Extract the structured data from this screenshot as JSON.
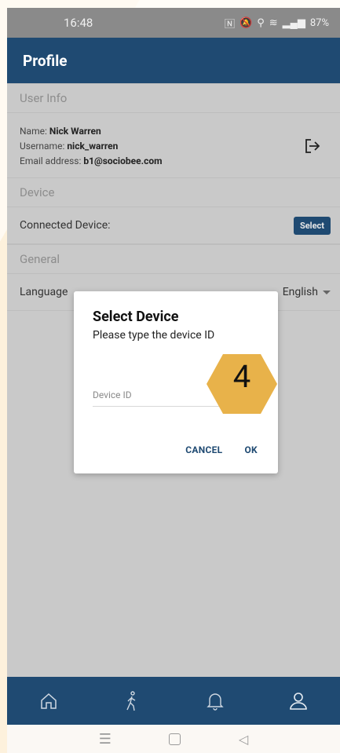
{
  "status_bar": {
    "time": "16:48",
    "speed": "99.0\nKB/S",
    "battery": "87%"
  },
  "app_bar": {
    "title": "Profile"
  },
  "sections": {
    "user_info": "User Info",
    "device": "Device",
    "general": "General"
  },
  "user": {
    "name_label": "Name: ",
    "name": "Nick Warren",
    "username_label": "Username: ",
    "username": "nick_warren",
    "email_label": "Email address: ",
    "email": "b1@sociobee.com"
  },
  "device": {
    "connected_label": "Connected Device:",
    "select_label": "Select"
  },
  "general": {
    "language_label": "Language",
    "language_value": "English"
  },
  "dialog": {
    "title": "Select Device",
    "subtitle": "Please type the device ID",
    "input_placeholder": "Device ID",
    "cancel_label": "CANCEL",
    "ok_label": "OK"
  },
  "badge": {
    "number": "4",
    "color": "#e8b24a"
  },
  "colors": {
    "primary": "#1f4a72",
    "overlay": "#cfcfcf"
  },
  "bottom_nav": [
    "home-icon",
    "walk-icon",
    "bell-icon",
    "person-icon"
  ],
  "system_nav": [
    "recents-icon",
    "home-square-icon",
    "back-icon"
  ]
}
